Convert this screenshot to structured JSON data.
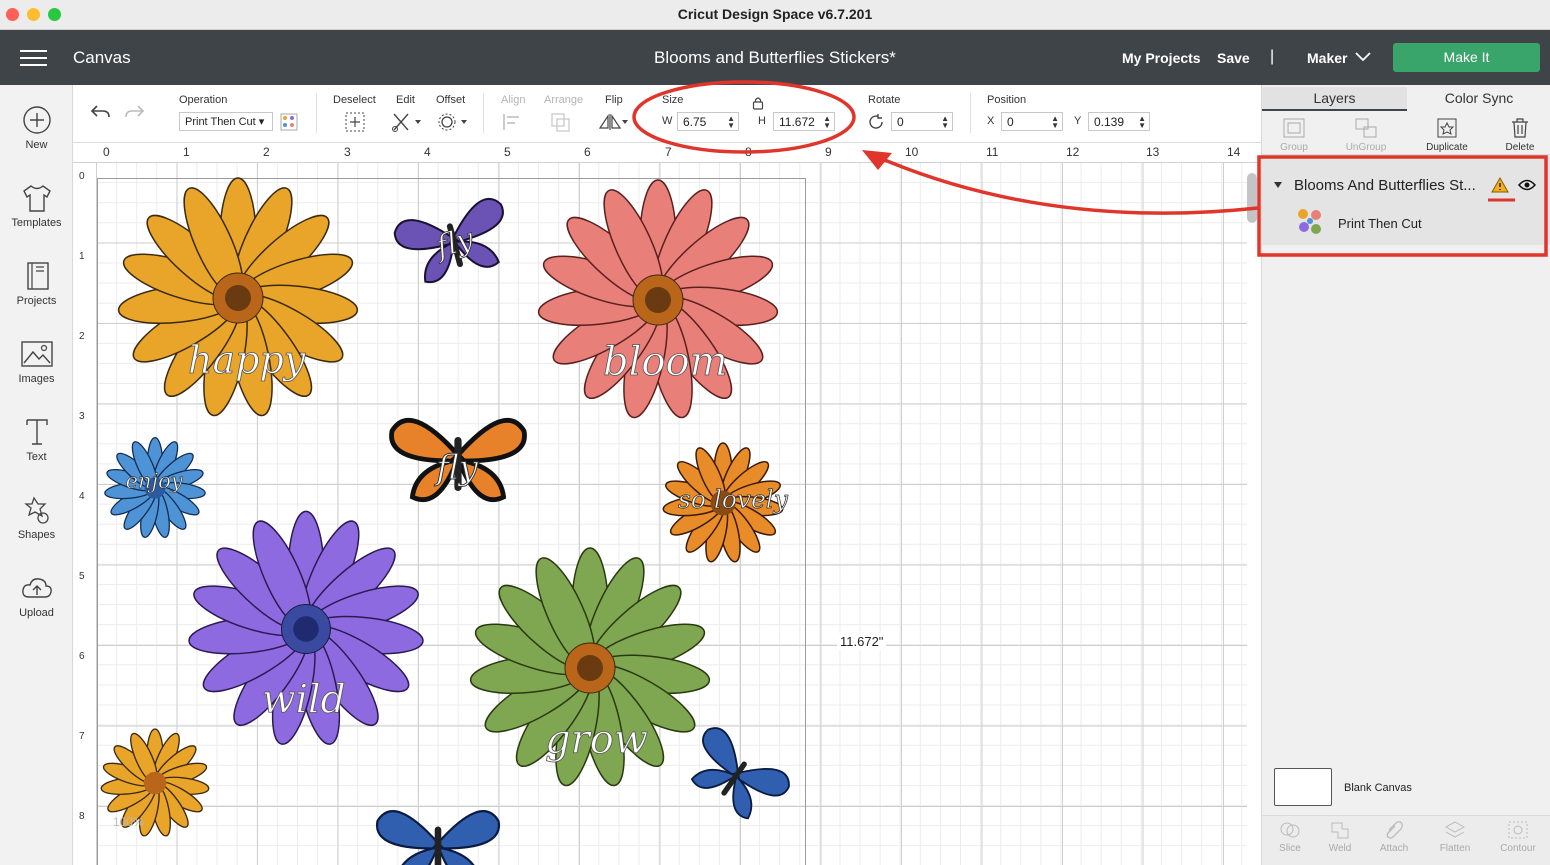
{
  "window": {
    "title": "Cricut Design Space  v6.7.201"
  },
  "header": {
    "section": "Canvas",
    "project_name": "Blooms and Butterflies Stickers*",
    "my_projects": "My Projects",
    "save": "Save",
    "separator": "|",
    "machine": "Maker",
    "make_it": "Make It"
  },
  "sidebar": {
    "items": [
      {
        "label": "New",
        "icon": "plus-circle-icon"
      },
      {
        "label": "Templates",
        "icon": "tshirt-icon"
      },
      {
        "label": "Projects",
        "icon": "book-icon"
      },
      {
        "label": "Images",
        "icon": "image-icon"
      },
      {
        "label": "Text",
        "icon": "text-icon"
      },
      {
        "label": "Shapes",
        "icon": "shapes-icon"
      },
      {
        "label": "Upload",
        "icon": "upload-cloud-icon"
      }
    ]
  },
  "toolbar": {
    "operation_label": "Operation",
    "operation_value": "Print Then Cut",
    "deselect_label": "Deselect",
    "edit_label": "Edit",
    "offset_label": "Offset",
    "align_label": "Align",
    "arrange_label": "Arrange",
    "flip_label": "Flip",
    "size_label": "Size",
    "w_label": "W",
    "w_value": "6.75",
    "h_label": "H",
    "h_value": "11.672",
    "rotate_label": "Rotate",
    "rotate_value": "0",
    "position_label": "Position",
    "x_label": "X",
    "x_value": "0",
    "y_label": "Y",
    "y_value": "0.139"
  },
  "ruler": {
    "top": [
      "0",
      "1",
      "2",
      "3",
      "4",
      "5",
      "6",
      "7",
      "8",
      "9",
      "10",
      "11",
      "12",
      "13",
      "14"
    ],
    "left": [
      "0",
      "1",
      "2",
      "3",
      "4",
      "5",
      "6",
      "7",
      "8"
    ]
  },
  "canvas": {
    "height_readout": "11.672\"",
    "zoom": "100%"
  },
  "right_panel": {
    "tab_layers": "Layers",
    "tab_color_sync": "Color Sync",
    "tools": [
      "Group",
      "UnGroup",
      "Duplicate",
      "Delete"
    ],
    "layer_group_name": "Blooms And Butterflies St...",
    "layer_child_name": "Print Then Cut",
    "blank_canvas": "Blank Canvas",
    "bottom_tools": [
      "Slice",
      "Weld",
      "Attach",
      "Flatten",
      "Contour"
    ]
  },
  "colors": {
    "header_bg": "#3f4449",
    "make_it_green": "#3aa56a",
    "annotation_red": "#e0352b",
    "warning_yellow": "#f2b01e"
  },
  "stickers": [
    {
      "flower_color": "#e8a52a",
      "word": "happy"
    },
    {
      "flower_color": "#e88079",
      "word": "bloom"
    },
    {
      "flower_color": "#8e6ae0",
      "word": "wild"
    },
    {
      "flower_color": "#7fa650",
      "word": "grow"
    },
    {
      "flower_color": "#4d93d6",
      "word": "enjoy"
    },
    {
      "flower_color": "#e88c2a",
      "word": "so lovely"
    },
    {
      "butterfly_color": "#6b52b5",
      "word": "fly"
    },
    {
      "butterfly_color": "#e8822a",
      "word": "fly"
    }
  ]
}
